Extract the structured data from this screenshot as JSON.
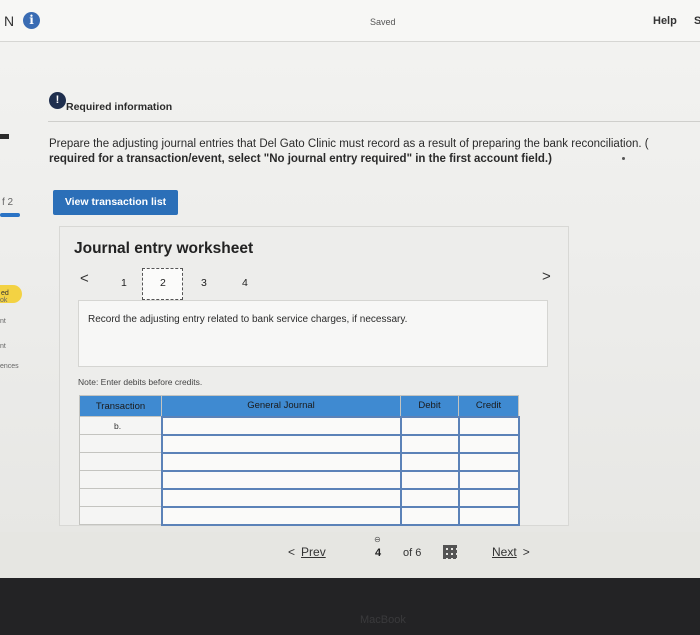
{
  "topbar": {
    "left_fragment": "N",
    "status": "Saved",
    "help_label": "Help",
    "right_fragment": "S"
  },
  "sidebar": {
    "page_fragment": "f 2",
    "badge_fragment": "ed",
    "items": [
      "ok",
      "nt",
      "nt",
      "ences"
    ]
  },
  "required": {
    "icon_glyph": "!",
    "label": "Required information"
  },
  "instructions": {
    "line1": "Prepare the adjusting journal entries that Del Gato Clinic must record as a result of preparing the bank reconciliation. (",
    "line2": "required for a transaction/event, select \"No journal entry required\" in the first account field.)"
  },
  "view_button_label": "View transaction list",
  "worksheet": {
    "title": "Journal entry worksheet",
    "pages": [
      "1",
      "2",
      "3",
      "4"
    ],
    "active_page": "2",
    "prev_chevron": "<",
    "next_chevron": ">",
    "entry_instruction": "Record the adjusting entry related to bank service charges, if necessary.",
    "note": "Note: Enter debits before credits."
  },
  "journal_table": {
    "headers": [
      "Transaction",
      "General Journal",
      "Debit",
      "Credit"
    ],
    "rows": [
      {
        "transaction": "b.",
        "general_journal": "",
        "debit": "",
        "credit": ""
      },
      {
        "transaction": "",
        "general_journal": "",
        "debit": "",
        "credit": ""
      },
      {
        "transaction": "",
        "general_journal": "",
        "debit": "",
        "credit": ""
      },
      {
        "transaction": "",
        "general_journal": "",
        "debit": "",
        "credit": ""
      },
      {
        "transaction": "",
        "general_journal": "",
        "debit": "",
        "credit": ""
      },
      {
        "transaction": "",
        "general_journal": "",
        "debit": "",
        "credit": ""
      }
    ]
  },
  "bottom_nav": {
    "prev_label": "Prev",
    "prev_chevron": "<",
    "current_page": "4",
    "of_label": "of 6",
    "next_label": "Next",
    "next_chevron": ">",
    "link_glyph": "⊖"
  },
  "bezel_text": "MacBook"
}
